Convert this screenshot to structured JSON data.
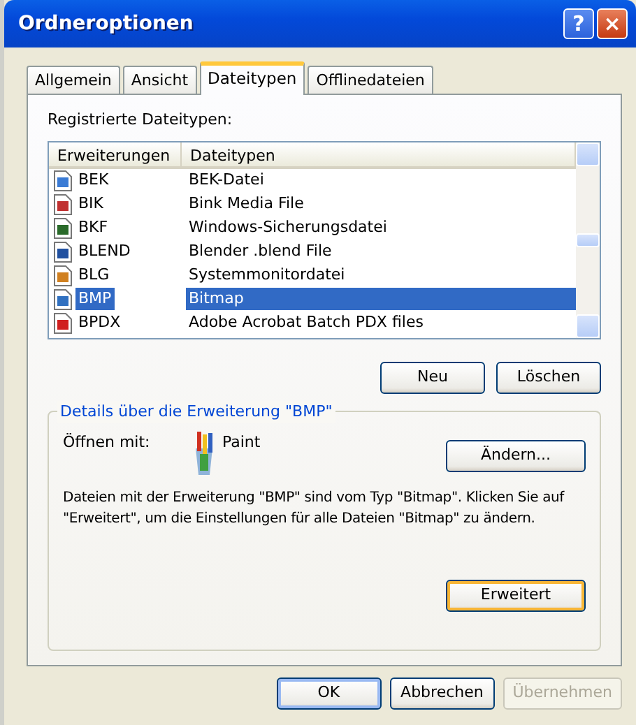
{
  "window": {
    "title": "Ordneroptionen",
    "controls": [
      "?",
      "×"
    ]
  },
  "tabs": [
    {
      "label": "Allgemein",
      "selected": false
    },
    {
      "label": "Ansicht",
      "selected": false
    },
    {
      "label": "Dateitypen",
      "selected": true
    },
    {
      "label": "Offlinedateien",
      "selected": false
    }
  ],
  "file_types": {
    "label": "Registrierte Dateitypen:",
    "columns": [
      "Erweiterungen",
      "Dateitypen"
    ],
    "rows": [
      {
        "extension": "BEK",
        "type": "BEK-Datei",
        "selected": false,
        "color": "#3a7bd5"
      },
      {
        "extension": "BIK",
        "type": "Bink Media File",
        "selected": false,
        "color": "#c03030"
      },
      {
        "extension": "BKF",
        "type": "Windows-Sicherungsdatei",
        "selected": false,
        "color": "#2a6a2a"
      },
      {
        "extension": "BLEND",
        "type": "Blender .blend File",
        "selected": false,
        "color": "#2050a0"
      },
      {
        "extension": "BLG",
        "type": "Systemmonitordatei",
        "selected": false,
        "color": "#d08020"
      },
      {
        "extension": "BMP",
        "type": "Bitmap",
        "selected": true,
        "color": "#3070c0"
      },
      {
        "extension": "BPDX",
        "type": "Adobe Acrobat Batch PDX files",
        "selected": false,
        "color": "#d02020"
      }
    ],
    "buttons": [
      {
        "label": "Neu",
        "focused": false
      },
      {
        "label": "Löschen",
        "focused": false
      }
    ]
  },
  "details": {
    "title": "Details über die Erweiterung \"BMP\"",
    "open_with_label": "Öffnen mit:",
    "program": "Paint",
    "change_button": {
      "label": "Ändern...",
      "focused": false
    },
    "description": "Dateien mit der Erweiterung \"BMP\" sind vom Typ \"Bitmap\". Klicken Sie auf \"Erweitert\", um die Einstellungen für alle Dateien \"Bitmap\" zu ändern.",
    "advanced_button": {
      "label": "Erweitert",
      "focused": true
    }
  },
  "footer_buttons": [
    {
      "label": "OK",
      "default": true,
      "disabled": false
    },
    {
      "label": "Abbrechen",
      "default": false,
      "disabled": false
    },
    {
      "label": "Übernehmen",
      "default": false,
      "disabled": true
    }
  ]
}
